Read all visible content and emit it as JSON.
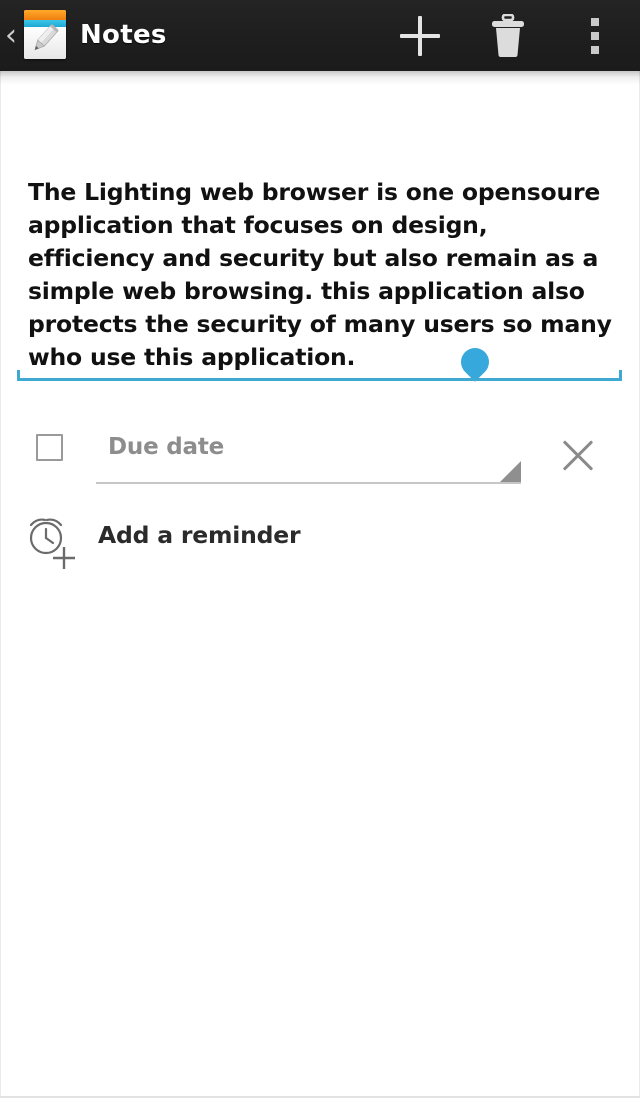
{
  "app": {
    "title": "Notes",
    "icon_name": "notepad-pencil-icon",
    "bar_background": "#1e1e1e",
    "title_color": "#ffffff"
  },
  "action_bar": {
    "back_label": "‹",
    "actions": [
      {
        "name": "add-note",
        "icon": "plus-icon",
        "label": "Add"
      },
      {
        "name": "delete-note",
        "icon": "trash-icon",
        "label": "Delete"
      },
      {
        "name": "overflow-menu",
        "icon": "more-vertical-icon",
        "label": "More options"
      }
    ]
  },
  "note": {
    "body_text": "The Lighting web browser is one opensoure application that focuses on design, efficiency and security but also remain as a simple web browsing. this application also protects the security of many users so many who use this application.",
    "underline_color": "#3fa9d4",
    "caret_handle_color": "#36a8dc",
    "caret_handle_icon": "text-cursor-handle-icon"
  },
  "due_date": {
    "checkbox_checked": false,
    "checkbox_name": "due-date-checkbox",
    "label": "Due date",
    "label_color": "#8d8d8d",
    "dropdown_icon": "spinner-triangle-icon",
    "clear_icon": "close-x-icon"
  },
  "reminder": {
    "icon": "alarm-clock-add-icon",
    "label": "Add a reminder",
    "label_color": "#2b2b2b"
  }
}
